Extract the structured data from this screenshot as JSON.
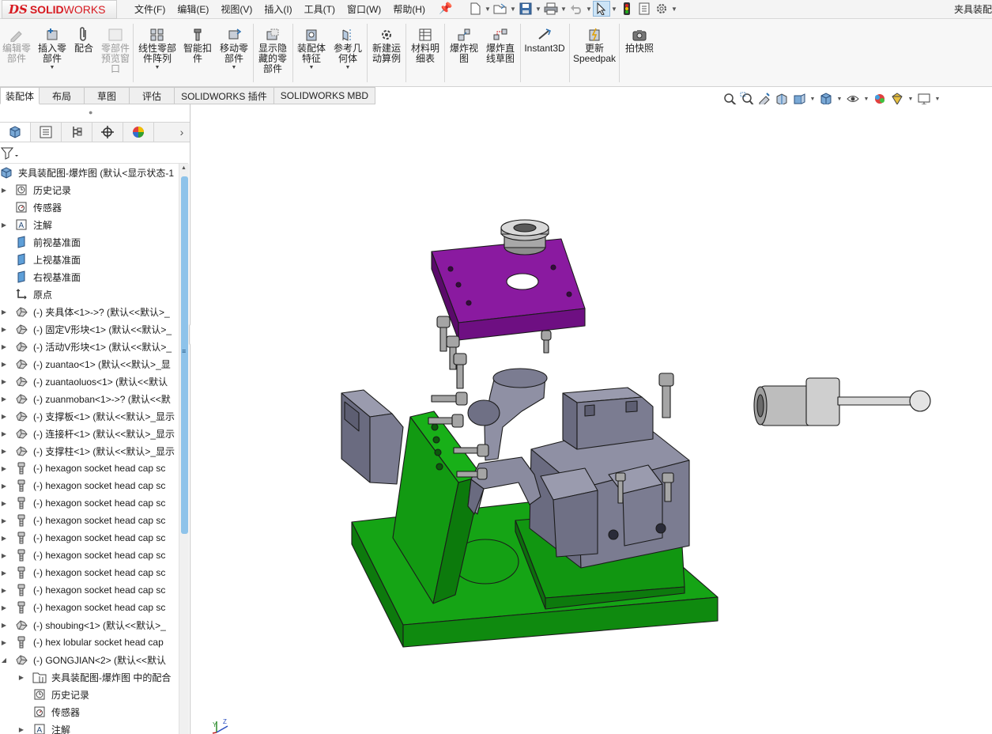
{
  "app": {
    "logo_ds": "DS",
    "logo_solid": "SOLID",
    "logo_works": "WORKS",
    "document_title": "夹具装配"
  },
  "menu": [
    "文件(F)",
    "编辑(E)",
    "视图(V)",
    "插入(I)",
    "工具(T)",
    "窗口(W)",
    "帮助(H)"
  ],
  "quick_access": [
    "new-document-icon",
    "open-icon",
    "save-icon",
    "print-icon",
    "undo-icon",
    "select-arrow-icon",
    "rebuild-traffic-light-icon",
    "file-properties-icon",
    "options-gear-icon"
  ],
  "commands": [
    {
      "id": "edit-component",
      "label": "编辑零\n部件",
      "enabled": false,
      "icon": "edit-component-icon"
    },
    {
      "id": "insert-components",
      "label": "插入零\n部件",
      "enabled": true,
      "icon": "insert-component-icon",
      "dropdown": true
    },
    {
      "id": "mate",
      "label": "配合",
      "enabled": true,
      "icon": "mate-paperclip-icon"
    },
    {
      "id": "component-preview",
      "label": "零部件\n预览窗\n口",
      "enabled": false,
      "icon": "preview-window-icon"
    },
    {
      "id": "linear-pattern",
      "label": "线性零部\n件阵列",
      "enabled": true,
      "icon": "linear-pattern-icon",
      "dropdown": true
    },
    {
      "id": "smart-fasteners",
      "label": "智能扣\n件",
      "enabled": true,
      "icon": "smart-fastener-icon"
    },
    {
      "id": "move-component",
      "label": "移动零\n部件",
      "enabled": true,
      "icon": "move-component-icon",
      "dropdown": true
    },
    {
      "id": "show-hidden",
      "label": "显示隐\n藏的零\n部件",
      "enabled": true,
      "icon": "show-hidden-icon"
    },
    {
      "id": "assembly-features",
      "label": "装配体\n特征",
      "enabled": true,
      "icon": "assembly-feature-icon",
      "dropdown": true
    },
    {
      "id": "reference-geometry",
      "label": "参考几\n何体",
      "enabled": true,
      "icon": "reference-geometry-icon",
      "dropdown": true
    },
    {
      "id": "new-motion-study",
      "label": "新建运\n动算例",
      "enabled": true,
      "icon": "motion-study-icon"
    },
    {
      "id": "bill-of-materials",
      "label": "材料明\n细表",
      "enabled": true,
      "icon": "bom-table-icon"
    },
    {
      "id": "exploded-view",
      "label": "爆炸视\n图",
      "enabled": true,
      "icon": "exploded-view-icon"
    },
    {
      "id": "explode-line-sketch",
      "label": "爆炸直\n线草图",
      "enabled": true,
      "icon": "explode-line-icon"
    },
    {
      "id": "instant3d",
      "label": "Instant3D",
      "enabled": true,
      "icon": "instant3d-icon"
    },
    {
      "id": "update-speedpak",
      "label": "更新\nSpeedpak",
      "enabled": true,
      "icon": "speedpak-icon"
    },
    {
      "id": "take-snapshot",
      "label": "拍快照",
      "enabled": true,
      "icon": "camera-icon"
    }
  ],
  "tabs": [
    {
      "label": "装配体",
      "active": true
    },
    {
      "label": "布局",
      "active": false
    },
    {
      "label": "草图",
      "active": false
    },
    {
      "label": "评估",
      "active": false
    },
    {
      "label": "SOLIDWORKS 插件",
      "active": false
    },
    {
      "label": "SOLIDWORKS MBD",
      "active": false
    }
  ],
  "heads_up_toolbar": [
    "zoom-to-fit-icon",
    "zoom-to-area-icon",
    "previous-view-icon",
    "section-view-icon",
    "dynamic-annotation-icon",
    "view-orientation-icon",
    "display-style-icon",
    "hide-show-items-icon",
    "edit-appearance-icon",
    "apply-scene-icon",
    "view-settings-icon"
  ],
  "feature_manager": {
    "tabs": [
      "feature-manager-icon",
      "property-manager-icon",
      "configuration-manager-icon",
      "dimxpert-icon",
      "display-manager-icon"
    ],
    "tree": [
      {
        "label": "夹具装配图-爆炸图  (默认<显示状态-1",
        "icon": "assembly-icon",
        "level": 0,
        "expander": "none"
      },
      {
        "label": "历史记录",
        "icon": "history-icon",
        "level": 1,
        "expander": "collapsed"
      },
      {
        "label": "传感器",
        "icon": "sensor-icon",
        "level": 1,
        "expander": "none"
      },
      {
        "label": "注解",
        "icon": "annotation-icon",
        "level": 1,
        "expander": "collapsed"
      },
      {
        "label": "前视基准面",
        "icon": "plane-icon",
        "level": 1,
        "expander": "none"
      },
      {
        "label": "上视基准面",
        "icon": "plane-icon",
        "level": 1,
        "expander": "none"
      },
      {
        "label": "右视基准面",
        "icon": "plane-icon",
        "level": 1,
        "expander": "none"
      },
      {
        "label": "原点",
        "icon": "origin-icon",
        "level": 1,
        "expander": "none"
      },
      {
        "label": "(-) 夹具体<1>->? (默认<<默认>_",
        "icon": "part-icon",
        "level": 1,
        "expander": "collapsed"
      },
      {
        "label": "(-) 固定V形块<1> (默认<<默认>_",
        "icon": "part-icon",
        "level": 1,
        "expander": "collapsed"
      },
      {
        "label": "(-) 活动V形块<1> (默认<<默认>_",
        "icon": "part-icon",
        "level": 1,
        "expander": "collapsed"
      },
      {
        "label": "(-) zuantao<1> (默认<<默认>_显",
        "icon": "part-icon",
        "level": 1,
        "expander": "collapsed"
      },
      {
        "label": "(-) zuantaoluos<1> (默认<<默认",
        "icon": "part-icon",
        "level": 1,
        "expander": "collapsed"
      },
      {
        "label": "(-) zuanmoban<1>->? (默认<<默",
        "icon": "part-icon",
        "level": 1,
        "expander": "collapsed"
      },
      {
        "label": "(-) 支撑板<1> (默认<<默认>_显示",
        "icon": "part-icon",
        "level": 1,
        "expander": "collapsed"
      },
      {
        "label": "(-) 连接杆<1> (默认<<默认>_显示",
        "icon": "part-icon",
        "level": 1,
        "expander": "collapsed"
      },
      {
        "label": "(-) 支撑柱<1> (默认<<默认>_显示",
        "icon": "part-icon",
        "level": 1,
        "expander": "collapsed"
      },
      {
        "label": "(-) hexagon socket head cap sc",
        "icon": "screw-icon",
        "level": 1,
        "expander": "collapsed"
      },
      {
        "label": "(-) hexagon socket head cap sc",
        "icon": "screw-icon",
        "level": 1,
        "expander": "collapsed"
      },
      {
        "label": "(-) hexagon socket head cap sc",
        "icon": "screw-icon",
        "level": 1,
        "expander": "collapsed"
      },
      {
        "label": "(-) hexagon socket head cap sc",
        "icon": "screw-icon",
        "level": 1,
        "expander": "collapsed"
      },
      {
        "label": "(-) hexagon socket head cap sc",
        "icon": "screw-icon",
        "level": 1,
        "expander": "collapsed"
      },
      {
        "label": "(-) hexagon socket head cap sc",
        "icon": "screw-icon",
        "level": 1,
        "expander": "collapsed"
      },
      {
        "label": "(-) hexagon socket head cap sc",
        "icon": "screw-icon",
        "level": 1,
        "expander": "collapsed"
      },
      {
        "label": "(-) hexagon socket head cap sc",
        "icon": "screw-icon",
        "level": 1,
        "expander": "collapsed"
      },
      {
        "label": "(-) hexagon socket head cap sc",
        "icon": "screw-icon",
        "level": 1,
        "expander": "collapsed"
      },
      {
        "label": "(-) shoubing<1> (默认<<默认>_",
        "icon": "part-icon",
        "level": 1,
        "expander": "collapsed"
      },
      {
        "label": "(-) hex lobular socket head cap",
        "icon": "screw-icon",
        "level": 1,
        "expander": "collapsed"
      },
      {
        "label": "(-) GONGJIAN<2> (默认<<默认",
        "icon": "part-icon",
        "level": 1,
        "expander": "expanded"
      },
      {
        "label": "夹具装配图-爆炸图 中的配合",
        "icon": "mates-folder-icon",
        "level": 2,
        "expander": "collapsed"
      },
      {
        "label": "历史记录",
        "icon": "history-icon",
        "level": 2,
        "expander": "none"
      },
      {
        "label": "传感器",
        "icon": "sensor-icon",
        "level": 2,
        "expander": "none"
      },
      {
        "label": "注解",
        "icon": "annotation-icon",
        "level": 2,
        "expander": "collapsed"
      }
    ]
  },
  "colors": {
    "plate_purple": "#7a0f8e",
    "base_green": "#0f8a0f",
    "fixture_gray": "#7b7c91",
    "screw_gray": "#9a9a9a",
    "accent_blue": "#8ec3ea"
  },
  "triad_labels": {
    "y": "Y",
    "z": "Z"
  }
}
